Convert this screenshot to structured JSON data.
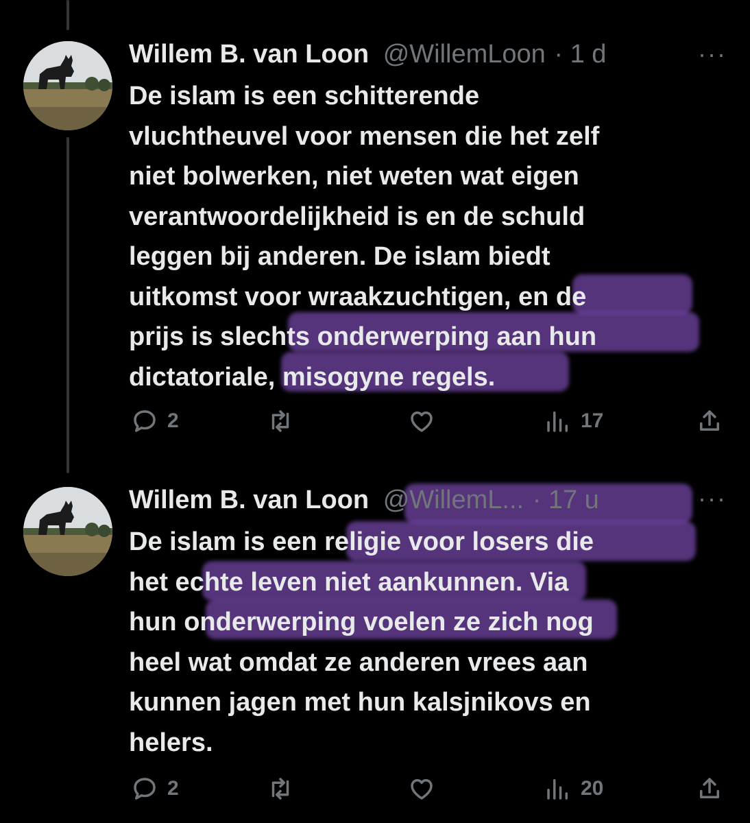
{
  "tweets": [
    {
      "author_name": "Willem B. van Loon",
      "handle": "@WillemLoon",
      "separator": "·",
      "time": "1 d",
      "more": "···",
      "lines": [
        "De islam is een schitterende",
        "vluchtheuvel voor mensen die het zelf",
        "niet bolwerken, niet weten wat eigen",
        "verantwoordelijkheid is en de schuld",
        "leggen bij anderen. De islam biedt",
        "uitkomst voor wraakzuchtigen, en de",
        "prijs is slechts onderwerping aan hun",
        "dictatoriale, misogyne regels."
      ],
      "replies": "2",
      "views": "17",
      "avatar_icon": "bull-sign-avatar",
      "highlight_color": "#9b5fe0"
    },
    {
      "author_name": "Willem B. van Loon",
      "handle": "@WillemL...",
      "separator": "·",
      "time": "17 u",
      "more": "···",
      "lines": [
        "De islam is een religie voor losers die",
        "het echte leven niet aankunnen. Via",
        "hun onderwerping voelen ze zich nog",
        "heel wat omdat ze anderen vrees aan",
        "kunnen jagen met hun kalsjnikovs en",
        "helers."
      ],
      "replies": "2",
      "views": "20",
      "avatar_icon": "bull-sign-avatar",
      "highlight_color": "#9b5fe0"
    }
  ],
  "icons": {
    "reply": "reply-icon",
    "repost": "repost-icon",
    "like": "like-icon",
    "views": "views-icon",
    "share": "share-icon"
  },
  "colors": {
    "background": "#000000",
    "text": "#e7e9ea",
    "secondary": "#71767b",
    "highlight": "#9b5fe0"
  }
}
